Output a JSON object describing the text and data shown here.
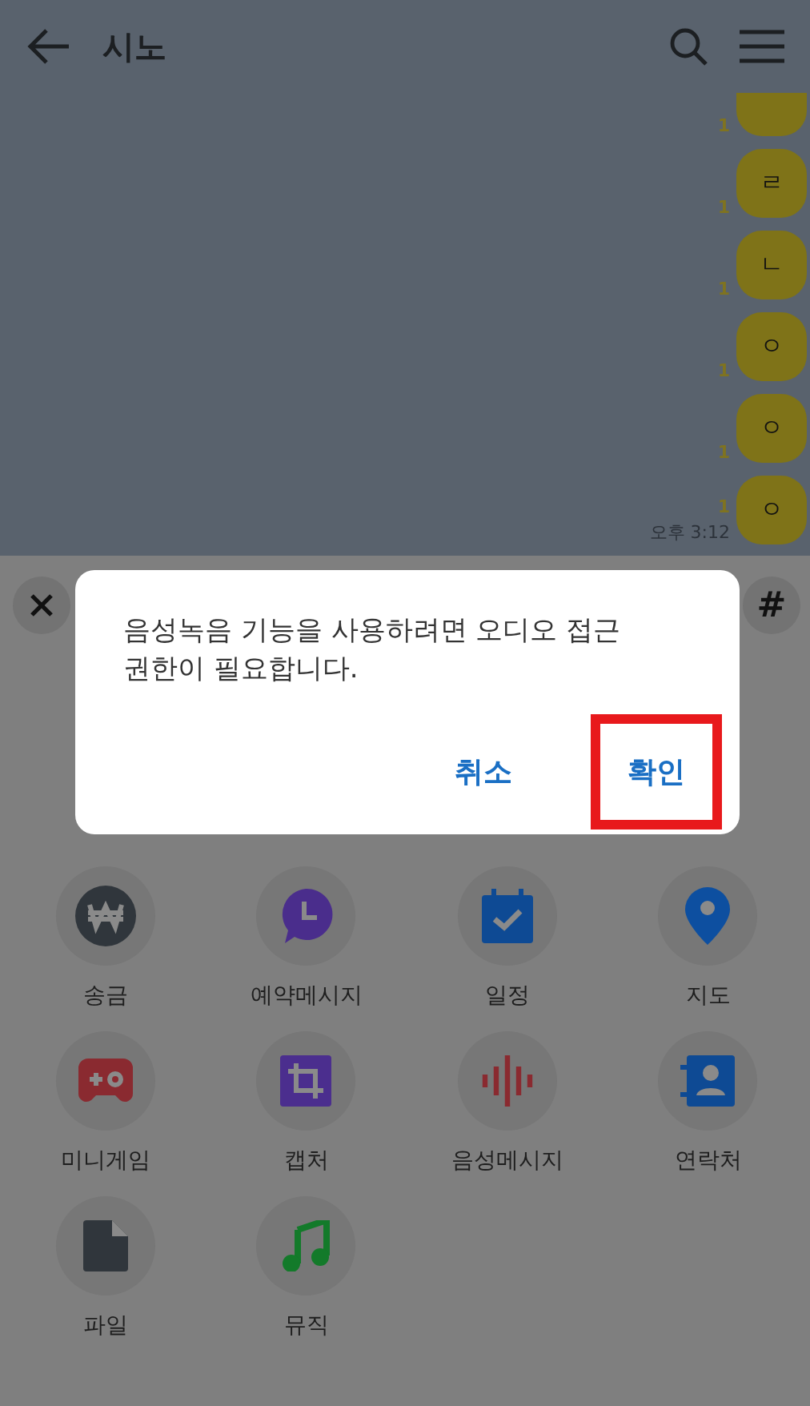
{
  "header": {
    "title": "시노"
  },
  "chat": {
    "messages": [
      {
        "read_count": "1"
      },
      {
        "text": "ㄹ",
        "read_count": "1"
      },
      {
        "text": "ㄴ",
        "read_count": "1"
      },
      {
        "text": "ㅇ",
        "read_count": "1"
      },
      {
        "text": "ㅇ",
        "read_count": "1"
      },
      {
        "text": "ㅇ",
        "read_count": "1",
        "time": "오후 3:12"
      }
    ]
  },
  "toolbar": {
    "hash": "#"
  },
  "dialog": {
    "message": "음성녹음 기능을 사용하려면 오디오 접근\n권한이 필요합니다.",
    "buttons": [
      {
        "label": "취소",
        "highlighted": false
      },
      {
        "label": "확인",
        "highlighted": true
      }
    ]
  },
  "attachments": [
    {
      "kind": "money",
      "label": "송금"
    },
    {
      "kind": "clock",
      "label": "예약메시지"
    },
    {
      "kind": "calendar",
      "label": "일정"
    },
    {
      "kind": "pin",
      "label": "지도"
    },
    {
      "kind": "game",
      "label": "미니게임"
    },
    {
      "kind": "crop",
      "label": "캡처"
    },
    {
      "kind": "wave",
      "label": "음성메시지"
    },
    {
      "kind": "contact",
      "label": "연락처"
    },
    {
      "kind": "file",
      "label": "파일"
    },
    {
      "kind": "music",
      "label": "뮤직"
    }
  ]
}
